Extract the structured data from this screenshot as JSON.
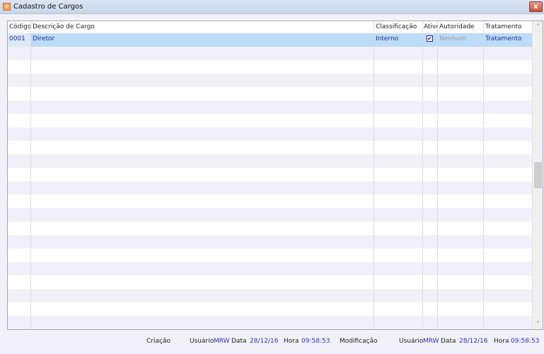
{
  "window": {
    "title": "Cadastro de Cargos",
    "close_label": "x"
  },
  "grid": {
    "columns": [
      "Código",
      "Descrição de Cargo",
      "Classificação",
      "Ativo",
      "Autoridade",
      "Tratamento"
    ],
    "rows": [
      {
        "codigo": "0001",
        "descricao": "Diretor",
        "classificacao": "Interno",
        "ativo": true,
        "autoridade": "Nenhum",
        "tratamento": "Tratamento"
      }
    ],
    "checkbox_mark": "✔"
  },
  "footer": {
    "criacao_label": "Criação",
    "usuario_label": "Usuário",
    "data_label": "Data",
    "hora_label": "Hora",
    "criacao": {
      "usuario": "MRW",
      "data": "28/12/16",
      "hora": "09:58:53"
    },
    "modificacao_label": "Modificação",
    "modificacao": {
      "usuario": "MRW",
      "data": "28/12/16",
      "hora": "09:58:53"
    }
  },
  "colors": {
    "selection": "#bcdcf8",
    "value_text": "#3030c0"
  }
}
